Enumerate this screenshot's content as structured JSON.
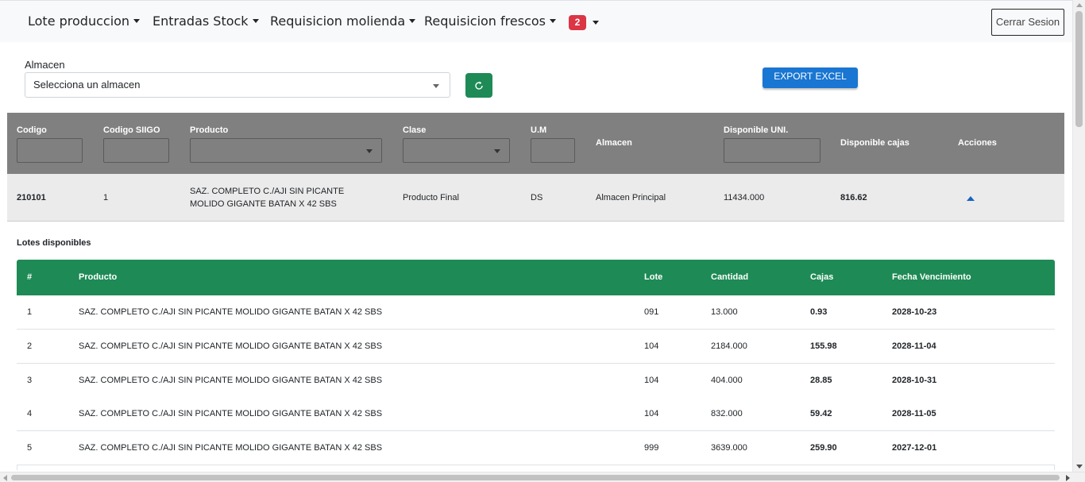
{
  "navbar": {
    "items": [
      {
        "label": "Lote produccion"
      },
      {
        "label": "Entradas Stock"
      },
      {
        "label": "Requisicion molienda"
      },
      {
        "label": "Requisicion frescos"
      }
    ],
    "notification_count": "2",
    "logout_label": "Cerrar Sesion"
  },
  "filters": {
    "almacen_label": "Almacen",
    "almacen_value": "Selecciona un almacen",
    "refresh_icon": "refresh-icon",
    "export_label": "EXPORT EXCEL"
  },
  "table": {
    "headers": {
      "codigo": "Codigo",
      "codigo_siigo": "Codigo SIIGO",
      "producto": "Producto",
      "clase": "Clase",
      "um": "U.M",
      "almacen": "Almacen",
      "disponible_uni": "Disponible UNI.",
      "disponible_cajas": "Disponible cajas",
      "acciones": "Acciones"
    },
    "rows": [
      {
        "codigo": "210101",
        "codigo_siigo": "1",
        "producto_line1": "SAZ. COMPLETO C./AJI SIN PICANTE",
        "producto_line2": "MOLIDO GIGANTE BATAN X 42 SBS",
        "clase": "Producto Final",
        "um": "DS",
        "almacen": "Almacen Principal",
        "disponible_uni": "11434.000",
        "disponible_cajas": "816.62"
      }
    ]
  },
  "lotes": {
    "title": "Lotes disponibles",
    "headers": {
      "num": "#",
      "producto": "Producto",
      "lote": "Lote",
      "cantidad": "Cantidad",
      "cajas": "Cajas",
      "fecha": "Fecha Vencimiento"
    },
    "rows": [
      {
        "num": "1",
        "producto": "SAZ. COMPLETO C./AJI SIN PICANTE MOLIDO GIGANTE BATAN X 42 SBS",
        "lote": "091",
        "cantidad": "13.000",
        "cajas": "0.93",
        "fecha": "2028-10-23"
      },
      {
        "num": "2",
        "producto": "SAZ. COMPLETO C./AJI SIN PICANTE MOLIDO GIGANTE BATAN X 42 SBS",
        "lote": "104",
        "cantidad": "2184.000",
        "cajas": "155.98",
        "fecha": "2028-11-04"
      },
      {
        "num": "3",
        "producto": "SAZ. COMPLETO C./AJI SIN PICANTE MOLIDO GIGANTE BATAN X 42 SBS",
        "lote": "104",
        "cantidad": "404.000",
        "cajas": "28.85",
        "fecha": "2028-10-31"
      },
      {
        "num": "4",
        "producto": "SAZ. COMPLETO C./AJI SIN PICANTE MOLIDO GIGANTE BATAN X 42 SBS",
        "lote": "104",
        "cantidad": "832.000",
        "cajas": "59.42",
        "fecha": "2028-11-05"
      },
      {
        "num": "5",
        "producto": "SAZ. COMPLETO C./AJI SIN PICANTE MOLIDO GIGANTE BATAN X 42 SBS",
        "lote": "999",
        "cantidad": "3639.000",
        "cajas": "259.90",
        "fecha": "2027-12-01"
      }
    ]
  },
  "colors": {
    "header_gray": "#808080",
    "green": "#1e8a55",
    "blue": "#1976d2",
    "badge_red": "#dc3545"
  }
}
